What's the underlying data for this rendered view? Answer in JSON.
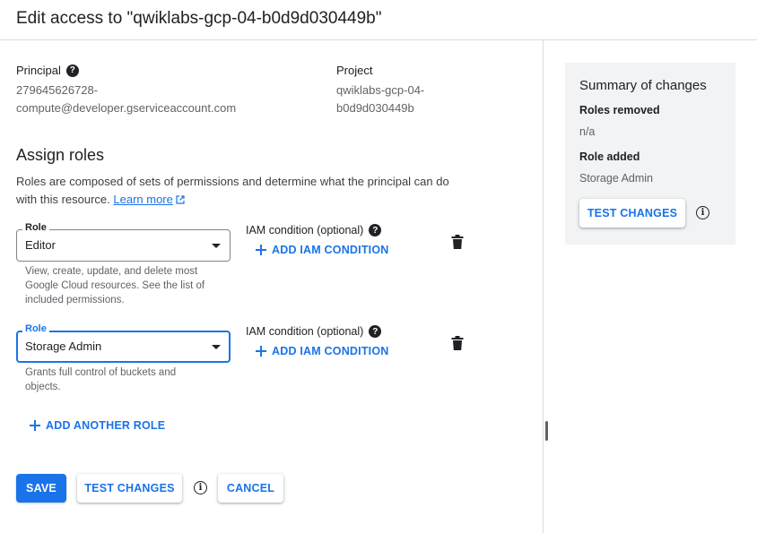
{
  "header": {
    "title": "Edit access to \"qwiklabs-gcp-04-b0d9d030449b\""
  },
  "principal": {
    "label": "Principal",
    "help_icon": "help-icon",
    "value_line1": "279645626728-",
    "value_line2": "compute@developer.gserviceaccount.com"
  },
  "project": {
    "label": "Project",
    "value_line1": "qwiklabs-gcp-04-",
    "value_line2": "b0d9d030449b"
  },
  "assign_roles": {
    "title": "Assign roles",
    "desc_line1": "Roles are composed of sets of permissions and determine what the principal can do",
    "desc_line2": "with this resource.",
    "learn_more": "Learn more"
  },
  "roles": [
    {
      "label": "Role",
      "value": "Editor",
      "hint_lines": [
        "View, create, update, and delete most",
        "Google Cloud resources. See the list of",
        "included permissions."
      ],
      "iam_label": "IAM condition (optional)",
      "add_condition": "ADD IAM CONDITION"
    },
    {
      "label": "Role",
      "value": "Storage Admin",
      "hint_lines": [
        "Grants full control of buckets and",
        "objects."
      ],
      "iam_label": "IAM condition (optional)",
      "add_condition": "ADD IAM CONDITION"
    }
  ],
  "add_another_role": "ADD ANOTHER ROLE",
  "footer": {
    "save": "SAVE",
    "test_changes": "TEST CHANGES",
    "cancel": "CANCEL"
  },
  "summary": {
    "title": "Summary of changes",
    "removed_label": "Roles removed",
    "removed_value": "n/a",
    "added_label": "Role added",
    "added_value": "Storage Admin",
    "test_changes": "TEST CHANGES"
  },
  "colors": {
    "accent": "#1a73e8",
    "panel_bg": "#f1f3f4",
    "divider": "#dadce0"
  }
}
